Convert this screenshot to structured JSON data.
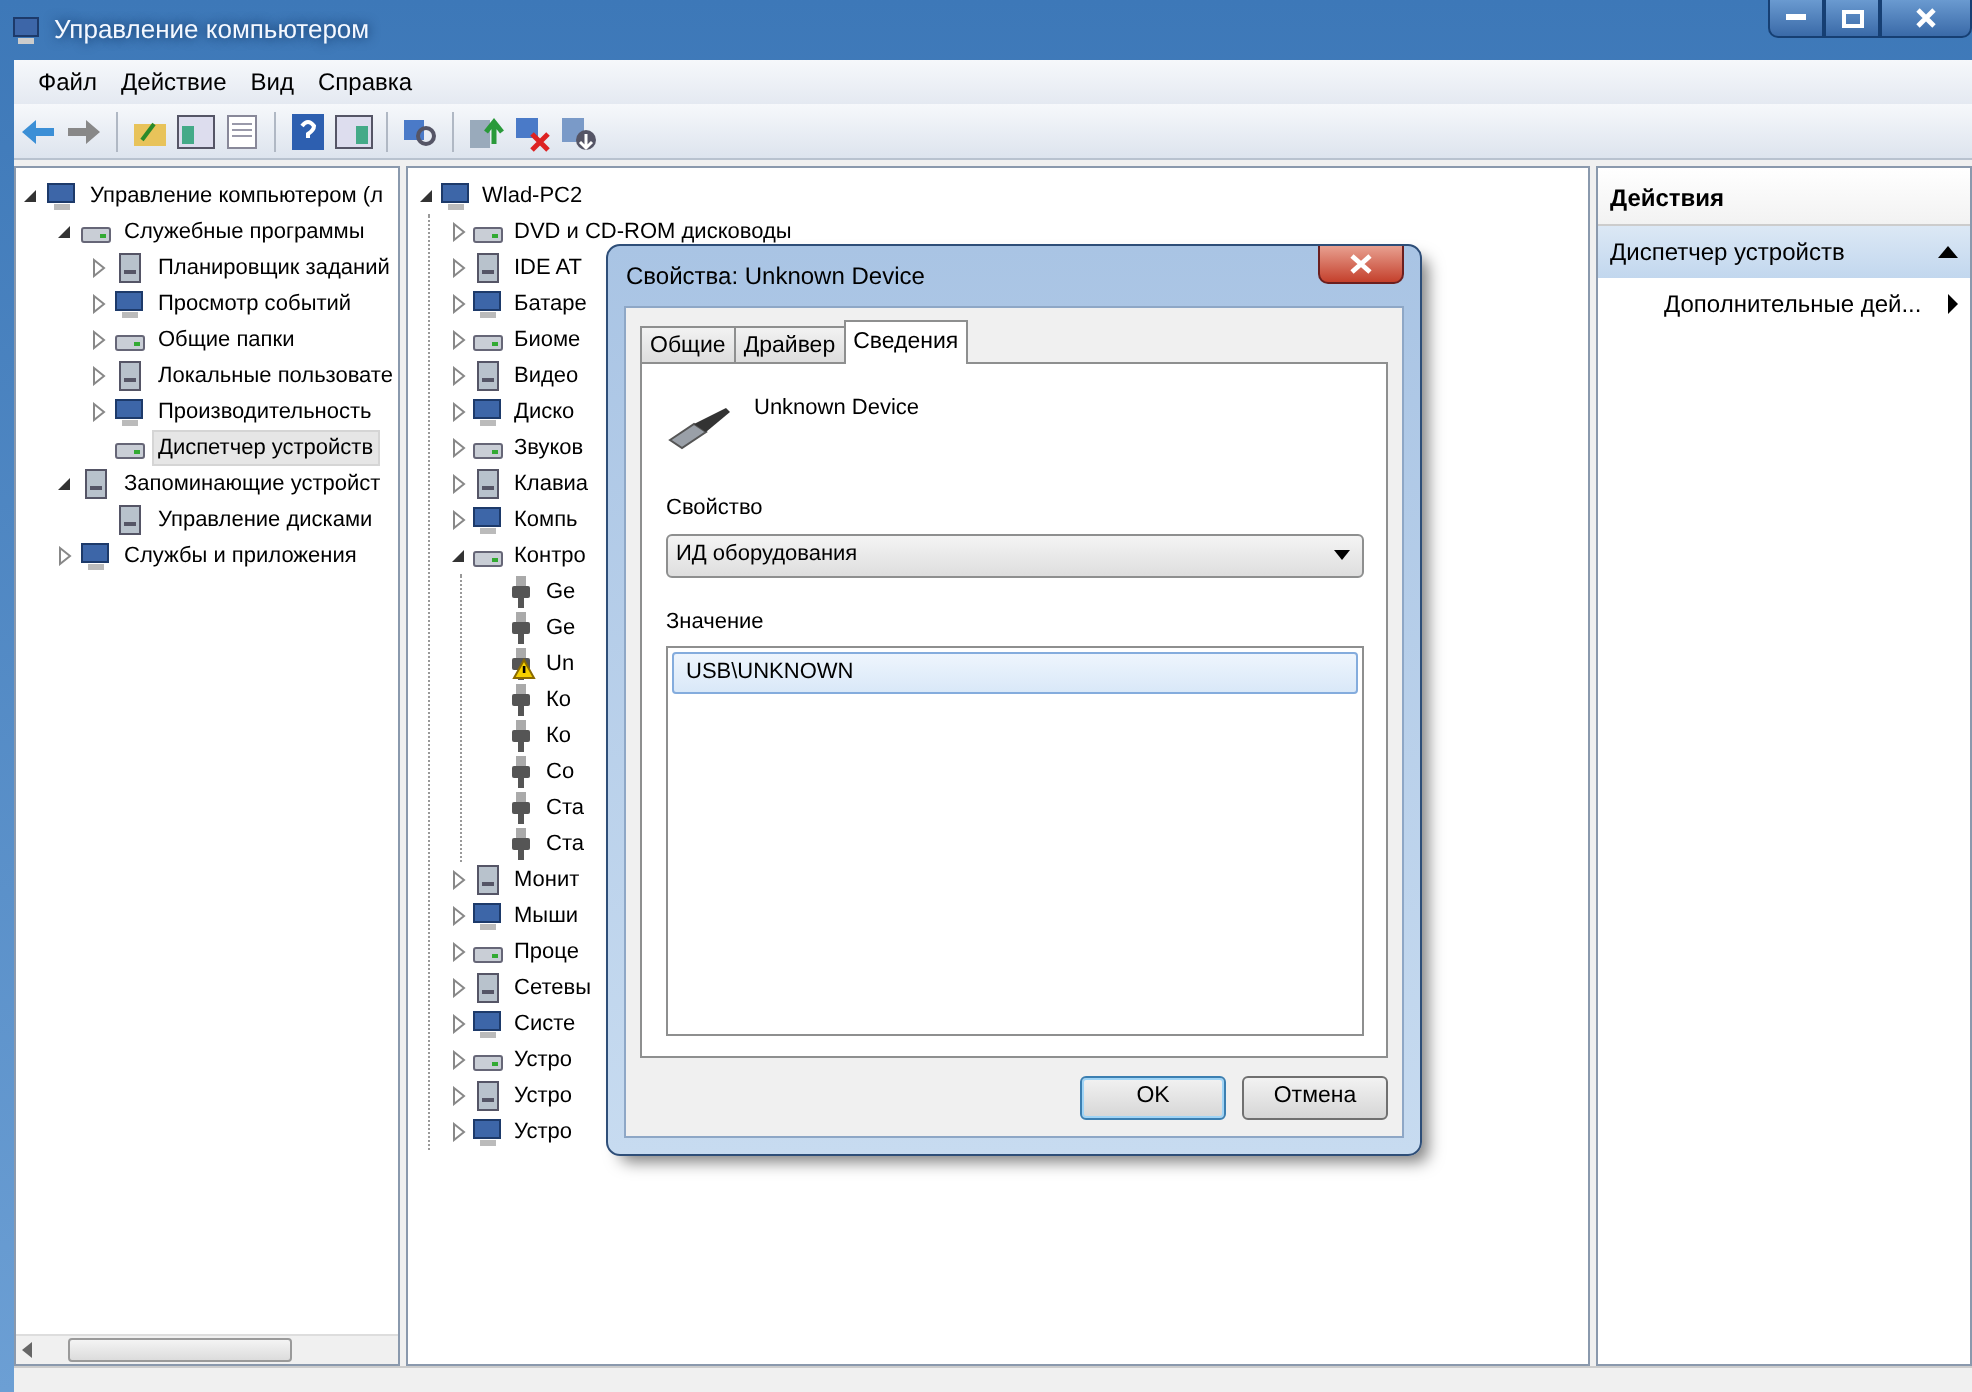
{
  "window": {
    "title": "Управление компьютером"
  },
  "menu": [
    "Файл",
    "Действие",
    "Вид",
    "Справка"
  ],
  "left_tree": [
    {
      "label": "Управление компьютером (л",
      "expanded": true,
      "children": [
        {
          "label": "Служебные программы",
          "expanded": true,
          "children": [
            {
              "label": "Планировщик заданий",
              "expanded": false
            },
            {
              "label": "Просмотр событий",
              "expanded": false
            },
            {
              "label": "Общие папки",
              "expanded": false
            },
            {
              "label": "Локальные пользовате",
              "expanded": false
            },
            {
              "label": "Производительность",
              "expanded": false
            },
            {
              "label": "Диспетчер устройств",
              "selected": true
            }
          ]
        },
        {
          "label": "Запоминающие устройст",
          "expanded": true,
          "children": [
            {
              "label": "Управление дисками",
              "selected": false
            }
          ]
        },
        {
          "label": "Службы и приложения",
          "expanded": false
        }
      ]
    }
  ],
  "device_tree": [
    {
      "label": "Wlad-PC2",
      "expanded": true,
      "children": [
        {
          "label": "DVD и CD-ROM дисководы",
          "expanded": false
        },
        {
          "label": "IDE AT",
          "expanded": false
        },
        {
          "label": "Батаре",
          "expanded": false
        },
        {
          "label": "Биоме",
          "expanded": false
        },
        {
          "label": "Видео",
          "expanded": false
        },
        {
          "label": "Диско",
          "expanded": false
        },
        {
          "label": "Звуков",
          "expanded": false
        },
        {
          "label": "Клавиа",
          "expanded": false
        },
        {
          "label": "Компь",
          "expanded": false
        },
        {
          "label": "Контро",
          "expanded": true,
          "children": [
            {
              "label": "Ge",
              "warning": false
            },
            {
              "label": "Ge",
              "warning": false
            },
            {
              "label": "Un",
              "warning": true
            },
            {
              "label": "Ко",
              "warning": false
            },
            {
              "label": "Ко",
              "warning": false
            },
            {
              "label": "Со",
              "warning": false
            },
            {
              "label": "Ста",
              "warning": false
            },
            {
              "label": "Ста",
              "warning": false
            }
          ]
        },
        {
          "label": "Монит",
          "expanded": false
        },
        {
          "label": "Мыши",
          "expanded": false
        },
        {
          "label": "Проце",
          "expanded": false
        },
        {
          "label": "Сетевы",
          "expanded": false
        },
        {
          "label": "Систе",
          "expanded": false
        },
        {
          "label": "Устро",
          "expanded": false
        },
        {
          "label": "Устро",
          "expanded": false
        },
        {
          "label": "Устро",
          "expanded": false
        }
      ]
    }
  ],
  "actions": {
    "title": "Действия",
    "section": "Диспетчер устройств",
    "item": "Дополнительные дей..."
  },
  "dialog": {
    "title": "Свойства: Unknown Device",
    "tabs": [
      {
        "label": "Общие",
        "selected": false
      },
      {
        "label": "Драйвер",
        "selected": false
      },
      {
        "label": "Сведения",
        "selected": true
      }
    ],
    "device_name": "Unknown Device",
    "property_label": "Свойство",
    "property_value": "ИД оборудования",
    "value_label": "Значение",
    "values": [
      {
        "text": "USB\\UNKNOWN",
        "selected": true
      }
    ],
    "buttons": [
      {
        "label": "OK",
        "default": true
      },
      {
        "label": "Отмена",
        "default": false
      }
    ]
  }
}
